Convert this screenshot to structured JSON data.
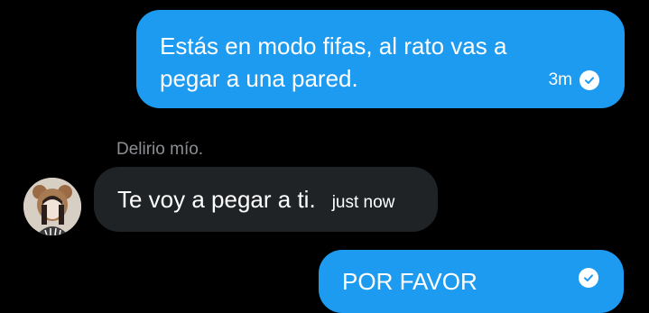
{
  "messages": [
    {
      "direction": "outgoing",
      "text": "Estás en modo fifas, al rato vas a pegar a una pared.",
      "time": "3m",
      "status_icon": "read-check-icon"
    },
    {
      "direction": "incoming",
      "sender": "Delirio mío.",
      "text": "Te voy a pegar a ti.",
      "time": "just now"
    },
    {
      "direction": "outgoing",
      "text": "POR FAVOR",
      "status_icon": "read-check-icon"
    }
  ],
  "colors": {
    "background": "#000000",
    "outgoing_bubble": "#1d9bf0",
    "incoming_bubble": "#1f2326",
    "sender_name": "#8b8f94"
  }
}
